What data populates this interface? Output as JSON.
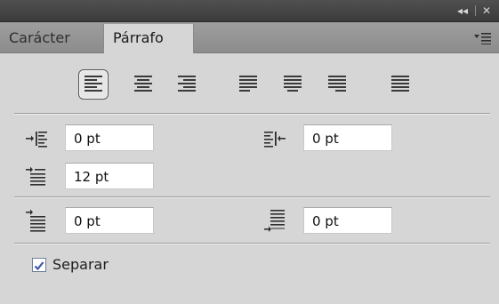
{
  "titlebar": {
    "collapse_glyph": "◂◂",
    "close_glyph": "✕",
    "icons": {
      "collapse": "collapse-arrows-icon",
      "close": "close-icon"
    }
  },
  "tabs": [
    {
      "label": "Carácter",
      "active": false
    },
    {
      "label": "Párrafo",
      "active": true
    }
  ],
  "panel_menu_icon": "panel-menu-icon",
  "alignment": {
    "buttons": [
      {
        "name": "align-left",
        "selected": true
      },
      {
        "name": "align-center",
        "selected": false
      },
      {
        "name": "align-right",
        "selected": false
      },
      {
        "name": "justify-last-left",
        "selected": false
      },
      {
        "name": "justify-last-center",
        "selected": false
      },
      {
        "name": "justify-last-right",
        "selected": false
      },
      {
        "name": "justify-all",
        "selected": false
      }
    ]
  },
  "indents": {
    "left_indent": "0 pt",
    "right_indent": "0 pt",
    "first_line_indent": "12 pt"
  },
  "spacing": {
    "space_before": "0 pt",
    "space_after": "0 pt"
  },
  "hyphenate": {
    "label": "Separar",
    "checked": true
  },
  "colors": {
    "titlebar": "#3f3f3f",
    "tabstrip": "#939393",
    "panel": "#d6d6d6",
    "check": "#3a56a6"
  }
}
